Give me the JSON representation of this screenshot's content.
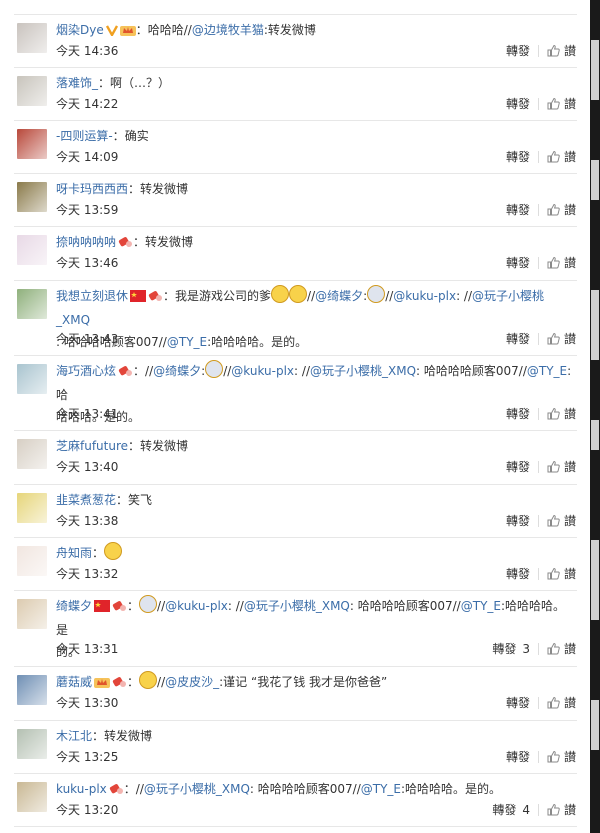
{
  "labels": {
    "repost": "轉發",
    "reply": "讃"
  },
  "comments": [
    {
      "user": "烟染Dye",
      "sep": "：",
      "text_parts": [
        {
          "t": "哈哈哈//",
          "link": false
        },
        {
          "t": "@边境牧羊猫",
          "link": true
        },
        {
          "t": ":转发微博",
          "link": false
        }
      ],
      "time": "今天 14:36",
      "repost_count": ""
    },
    {
      "user": "落难饰_",
      "sep": "：",
      "text_parts": [
        {
          "t": "啊（…？）",
          "link": false
        }
      ],
      "time": "今天 14:22",
      "repost_count": ""
    },
    {
      "user": "-四则运算-",
      "sep": "：",
      "text_parts": [
        {
          "t": "确实",
          "link": false
        }
      ],
      "time": "今天 14:09",
      "repost_count": ""
    },
    {
      "user": "呀卡玛西西西",
      "sep": "：",
      "text_parts": [
        {
          "t": "转发微博",
          "link": false
        }
      ],
      "time": "今天 13:59",
      "repost_count": ""
    },
    {
      "user": "捺呐呐呐呐",
      "sep": "：",
      "text_parts": [
        {
          "t": "转发微博",
          "link": false
        }
      ],
      "time": "今天 13:46",
      "repost_count": ""
    },
    {
      "user": "我想立刻退休",
      "sep": "：",
      "text_parts": [
        {
          "t": "我是游戏公司的爹",
          "link": false
        },
        {
          "t": "//",
          "link": false
        },
        {
          "t": "@绮蝶夕",
          "link": true
        },
        {
          "t": ":",
          "link": false
        },
        {
          "t": "//",
          "link": false
        },
        {
          "t": "@kuku-plx",
          "link": true
        },
        {
          "t": ": //",
          "link": false
        },
        {
          "t": "@玩子小樱桃_XMQ",
          "link": true
        }
      ],
      "line2": [
        {
          "t": ": 哈哈哈哈顾客007//",
          "link": false
        },
        {
          "t": "@TY_E",
          "link": true
        },
        {
          "t": ":哈哈哈哈。是的。",
          "link": false
        }
      ],
      "time": "今天 13:43",
      "repost_count": ""
    },
    {
      "user": "海巧酒心炫",
      "sep": "：",
      "text_parts": [
        {
          "t": "//",
          "link": false
        },
        {
          "t": "@绮蝶夕",
          "link": true
        },
        {
          "t": ":",
          "link": false
        },
        {
          "t": "//",
          "link": false
        },
        {
          "t": "@kuku-plx",
          "link": true
        },
        {
          "t": ": //",
          "link": false
        },
        {
          "t": "@玩子小樱桃_XMQ",
          "link": true
        },
        {
          "t": ": 哈哈哈哈顾客007//",
          "link": false
        },
        {
          "t": "@TY_E",
          "link": true
        },
        {
          "t": ":哈",
          "link": false
        }
      ],
      "line2": [
        {
          "t": "哈哈哈。是的。",
          "link": false
        }
      ],
      "time": "今天 13:41",
      "repost_count": ""
    },
    {
      "user": "芝麻fufuture",
      "sep": "：",
      "text_parts": [
        {
          "t": "转发微博",
          "link": false
        }
      ],
      "time": "今天 13:40",
      "repost_count": ""
    },
    {
      "user": "韭菜煮葱花",
      "sep": "：",
      "text_parts": [
        {
          "t": "笑飞",
          "link": false
        }
      ],
      "time": "今天 13:38",
      "repost_count": ""
    },
    {
      "user": "舟知雨",
      "sep": "：",
      "text_parts": [],
      "time": "今天 13:32",
      "repost_count": ""
    },
    {
      "user": "绮蝶夕",
      "sep": "：",
      "text_parts": [
        {
          "t": "//",
          "link": false
        },
        {
          "t": "@kuku-plx",
          "link": true
        },
        {
          "t": ": //",
          "link": false
        },
        {
          "t": "@玩子小樱桃_XMQ",
          "link": true
        },
        {
          "t": ": 哈哈哈哈顾客007//",
          "link": false
        },
        {
          "t": "@TY_E",
          "link": true
        },
        {
          "t": ":哈哈哈哈。是",
          "link": false
        }
      ],
      "line2": [
        {
          "t": "的。",
          "link": false
        }
      ],
      "time": "今天 13:31",
      "repost_count": "3"
    },
    {
      "user": "蘑菇威",
      "sep": "：",
      "text_parts": [
        {
          "t": "//",
          "link": false
        },
        {
          "t": "@皮皮沙_",
          "link": true
        },
        {
          "t": ":谨记 “我花了钱 我才是你爸爸”",
          "link": false
        }
      ],
      "time": "今天 13:30",
      "repost_count": ""
    },
    {
      "user": "木江北",
      "sep": "：",
      "text_parts": [
        {
          "t": "转发微博",
          "link": false
        }
      ],
      "time": "今天 13:25",
      "repost_count": ""
    },
    {
      "user": "kuku-plx",
      "sep": "：",
      "text_parts": [
        {
          "t": "//",
          "link": false
        },
        {
          "t": "@玩子小樱桃_XMQ",
          "link": true
        },
        {
          "t": ": 哈哈哈哈顾客007//",
          "link": false
        },
        {
          "t": "@TY_E",
          "link": true
        },
        {
          "t": ":哈哈哈哈。是的。",
          "link": false
        }
      ],
      "time": "今天 13:20",
      "repost_count": "4"
    }
  ],
  "avatar_colors": [
    "#c9c3be",
    "#c8c4bc",
    "#b8483a",
    "#8a7a4a",
    "#e8d9e6",
    "#8fb07c",
    "#a9c4cf",
    "#d7cfc4",
    "#e6d57a",
    "#f1e6e0",
    "#dccbb0",
    "#6f8fb4",
    "#b4c0b2",
    "#c9b894"
  ],
  "badges": {
    "0": [
      "v-icon",
      "crown-icon"
    ],
    "4": [
      "tag-icon"
    ],
    "5": [
      "flag-icon",
      "tag-icon"
    ],
    "6": [
      "tag-icon"
    ],
    "10": [
      "flag-icon",
      "tag-icon"
    ],
    "11": [
      "crown-icon",
      "tag-icon"
    ],
    "13": [
      "tag-icon"
    ]
  }
}
